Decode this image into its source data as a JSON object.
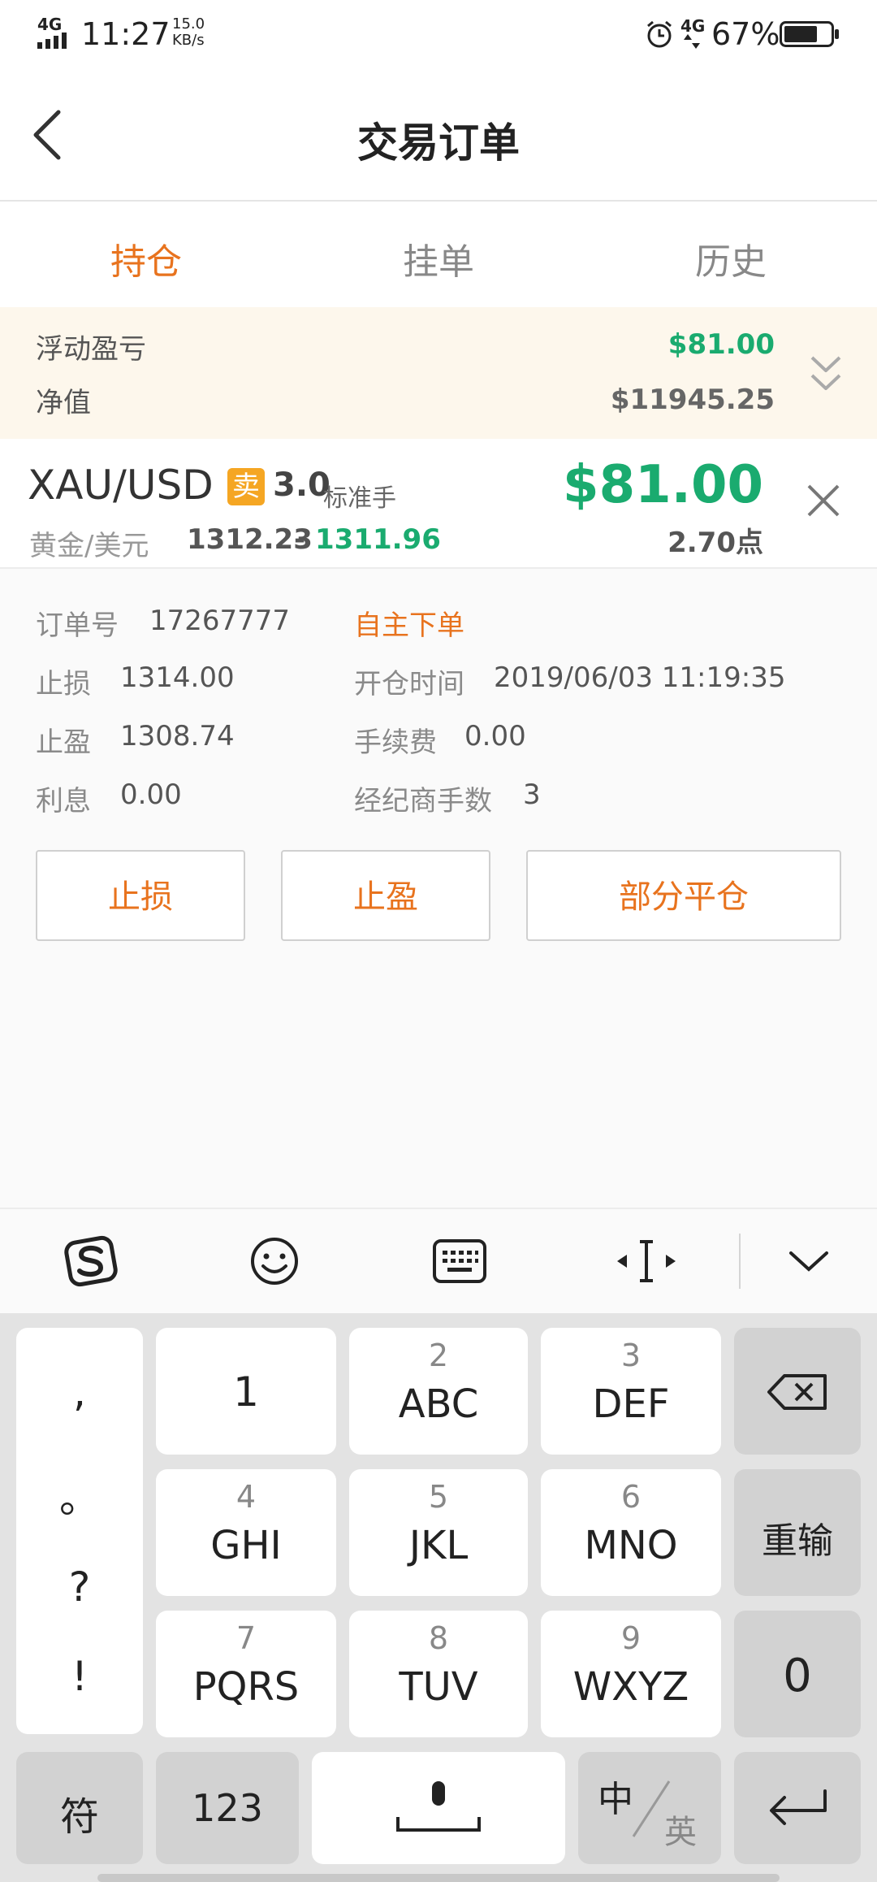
{
  "status_bar": {
    "network": "4G",
    "time": "11:27",
    "speed_value": "15.0",
    "speed_unit": "KB/s",
    "network2": "4G",
    "battery": "67%"
  },
  "header": {
    "title": "交易订单"
  },
  "tabs": [
    {
      "label": "持仓",
      "active": true
    },
    {
      "label": "挂单",
      "active": false
    },
    {
      "label": "历史",
      "active": false
    }
  ],
  "summary": {
    "floating_label": "浮动盈亏",
    "floating_value": "$81.00",
    "equity_label": "净值",
    "equity_value": "$11945.25"
  },
  "order": {
    "symbol": "XAU/USD",
    "side": "卖",
    "lots": "3.0",
    "lot_unit": "标准手",
    "name": "黄金/美元",
    "open_price": "1312.23",
    "separator": "-",
    "current_price": "1311.96",
    "profit": "$81.00",
    "points": "2.70点"
  },
  "details": {
    "order_no_label": "订单号",
    "order_no": "17267777",
    "source": "自主下单",
    "sl_label": "止损",
    "sl": "1314.00",
    "open_time_label": "开仓时间",
    "open_time": "2019/06/03 11:19:35",
    "tp_label": "止盈",
    "tp": "1308.74",
    "fee_label": "手续费",
    "fee": "0.00",
    "interest_label": "利息",
    "interest": "0.00",
    "broker_lots_label": "经纪商手数",
    "broker_lots": "3"
  },
  "actions": {
    "stop_loss": "止损",
    "take_profit": "止盈",
    "partial_close": "部分平仓"
  },
  "colors": {
    "accent": "#e8731e",
    "profit": "#1aab6f",
    "badge": "#f5a623",
    "summary_bg": "#fdf7ec"
  },
  "keyboard": {
    "punct": [
      ",",
      "。",
      "?",
      "!"
    ],
    "rows": [
      [
        {
          "num": "",
          "letters": "1"
        },
        {
          "num": "2",
          "letters": "ABC"
        },
        {
          "num": "3",
          "letters": "DEF"
        }
      ],
      [
        {
          "num": "4",
          "letters": "GHI"
        },
        {
          "num": "5",
          "letters": "JKL"
        },
        {
          "num": "6",
          "letters": "MNO"
        }
      ],
      [
        {
          "num": "7",
          "letters": "PQRS"
        },
        {
          "num": "8",
          "letters": "TUV"
        },
        {
          "num": "9",
          "letters": "WXYZ"
        }
      ]
    ],
    "reenter": "重输",
    "zero": "0",
    "symbols": "符",
    "numbers": "123",
    "lang_cn": "中",
    "lang_en": "英"
  }
}
